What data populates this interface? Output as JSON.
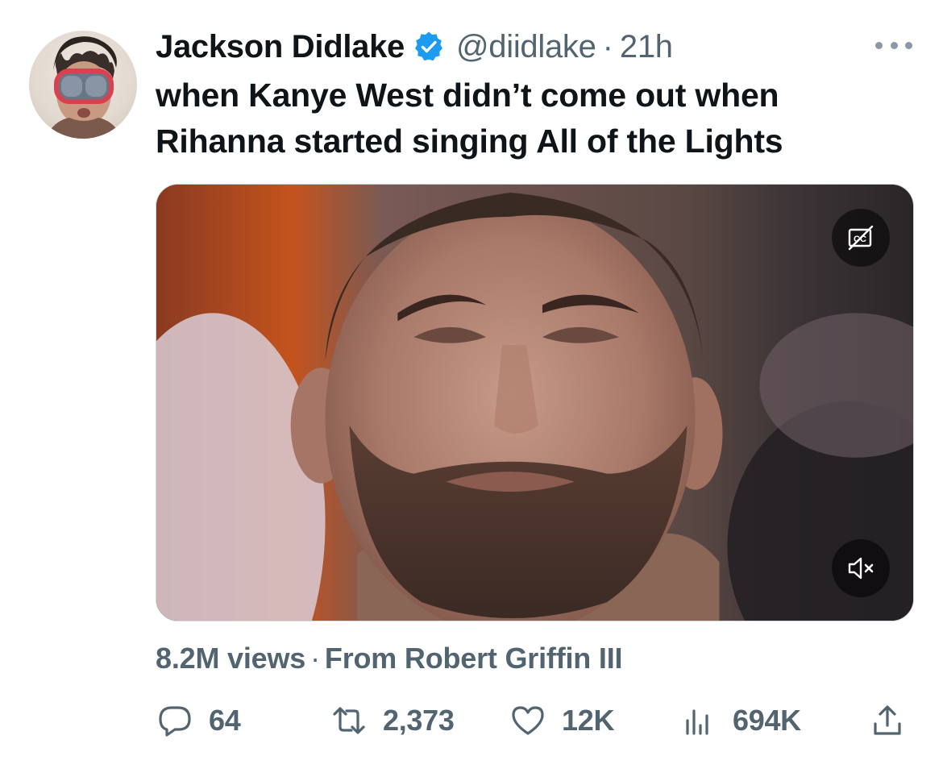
{
  "author": {
    "name": "Jackson Didlake",
    "handle": "@diidlake",
    "separator": "·",
    "time": "21h",
    "verified": true
  },
  "tweet": {
    "text": "when Kanye West didn’t come out when Rihanna started singing All of the Lights"
  },
  "media": {
    "type": "video",
    "controls": {
      "captions": "cc-icon",
      "mute": "muted-speaker-icon"
    }
  },
  "meta": {
    "views": "8.2M views",
    "separator": "·",
    "attribution": "From Robert Griffin III"
  },
  "actions": {
    "replies": "64",
    "retweets": "2,373",
    "likes": "12K",
    "views": "694K",
    "icons": [
      "reply-icon",
      "retweet-icon",
      "like-icon",
      "views-icon",
      "share-icon"
    ]
  },
  "colors": {
    "text": "#0f1419",
    "secondary": "#536471",
    "verified": "#1d9bf0"
  }
}
